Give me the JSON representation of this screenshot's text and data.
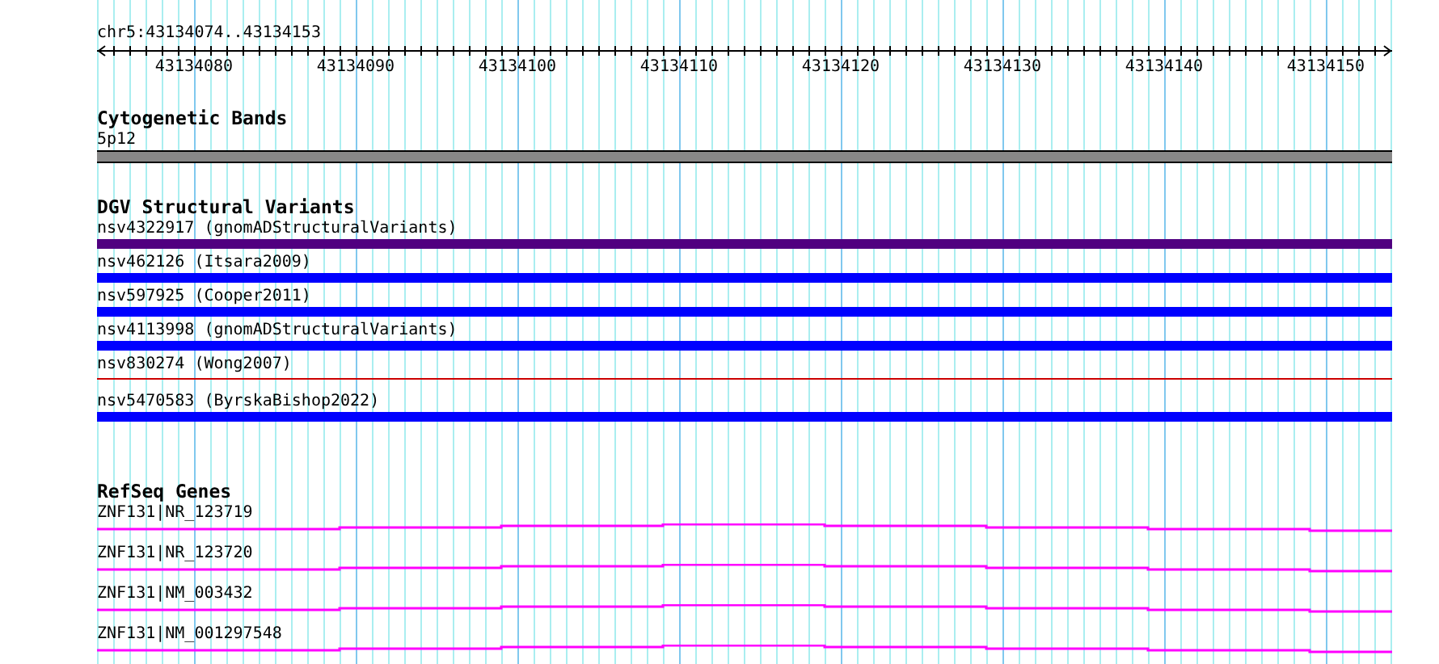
{
  "ruler": {
    "position": "chr5:43134074..43134153",
    "tick_labels": [
      "43134080",
      "43134090",
      "43134100",
      "43134110",
      "43134120",
      "43134130",
      "43134140",
      "43134150"
    ]
  },
  "cytogenetic_bands": {
    "title": "Cytogenetic Bands",
    "band": "5p12"
  },
  "dgv_structural_variants": {
    "title": "DGV Structural Variants",
    "items": [
      {
        "label": "nsv4322917 (gnomADStructuralVariants)",
        "color": "#500080",
        "kind": "thick"
      },
      {
        "label": "nsv462126 (Itsara2009)",
        "color": "#0000ff",
        "kind": "thick"
      },
      {
        "label": "nsv597925 (Cooper2011)",
        "color": "#0000ff",
        "kind": "thick"
      },
      {
        "label": "nsv4113998 (gnomADStructuralVariants)",
        "color": "#0000ff",
        "kind": "thick"
      },
      {
        "label": "nsv830274 (Wong2007)",
        "color": "#cc0000",
        "kind": "thin"
      },
      {
        "label": "nsv5470583 (ByrskaBishop2022)",
        "color": "#0000ff",
        "kind": "thick"
      }
    ]
  },
  "refseq_genes": {
    "title": "RefSeq Genes",
    "items": [
      {
        "label": "ZNF131|NR_123719"
      },
      {
        "label": "ZNF131|NR_123720"
      },
      {
        "label": "ZNF131|NM_003432"
      },
      {
        "label": "ZNF131|NM_001297548"
      }
    ]
  }
}
